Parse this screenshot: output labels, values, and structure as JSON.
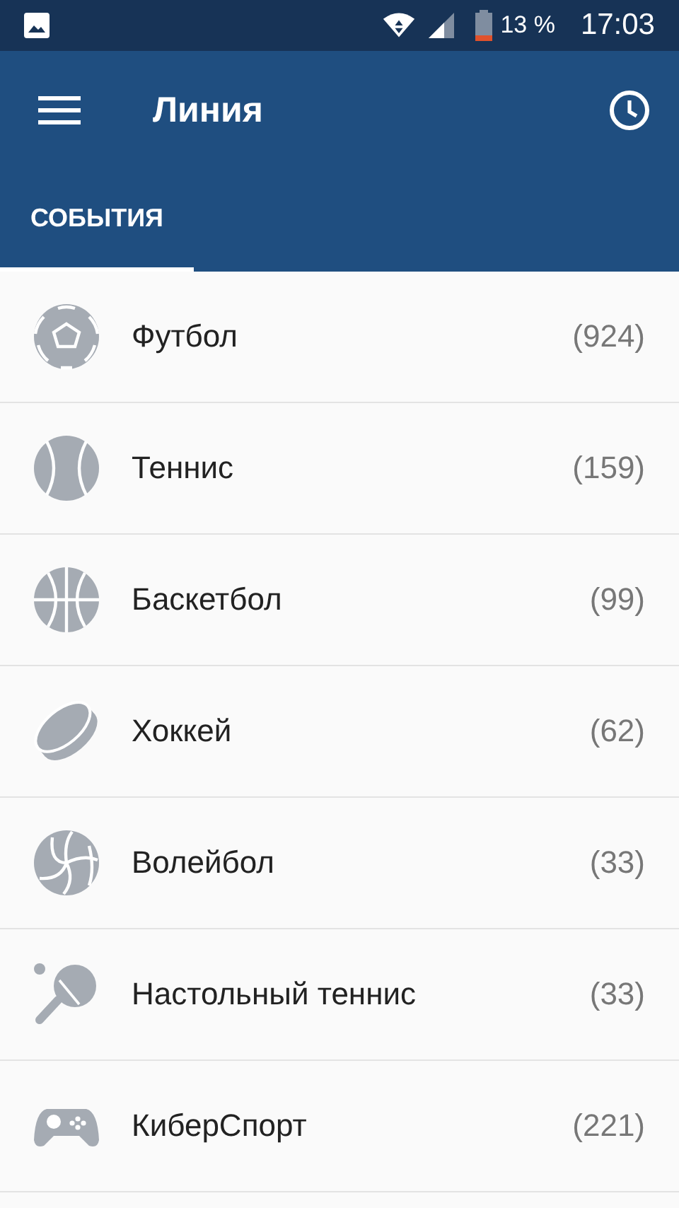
{
  "status_bar": {
    "battery": "13 %",
    "time": "17:03"
  },
  "toolbar": {
    "title": "Линия"
  },
  "tabs": [
    {
      "label": "СОБЫТИЯ",
      "selected": true
    }
  ],
  "sports": [
    {
      "kind": "football",
      "name": "Футбол",
      "count": "(924)"
    },
    {
      "kind": "tennis",
      "name": "Теннис",
      "count": "(159)"
    },
    {
      "kind": "basketball",
      "name": "Баскетбол",
      "count": "(99)"
    },
    {
      "kind": "hockey",
      "name": "Хоккей",
      "count": "(62)"
    },
    {
      "kind": "volleyball",
      "name": "Волейбол",
      "count": "(33)"
    },
    {
      "kind": "tabletennis",
      "name": "Настольный теннис",
      "count": "(33)"
    },
    {
      "kind": "esports",
      "name": "КиберСпорт",
      "count": "(221)"
    }
  ]
}
